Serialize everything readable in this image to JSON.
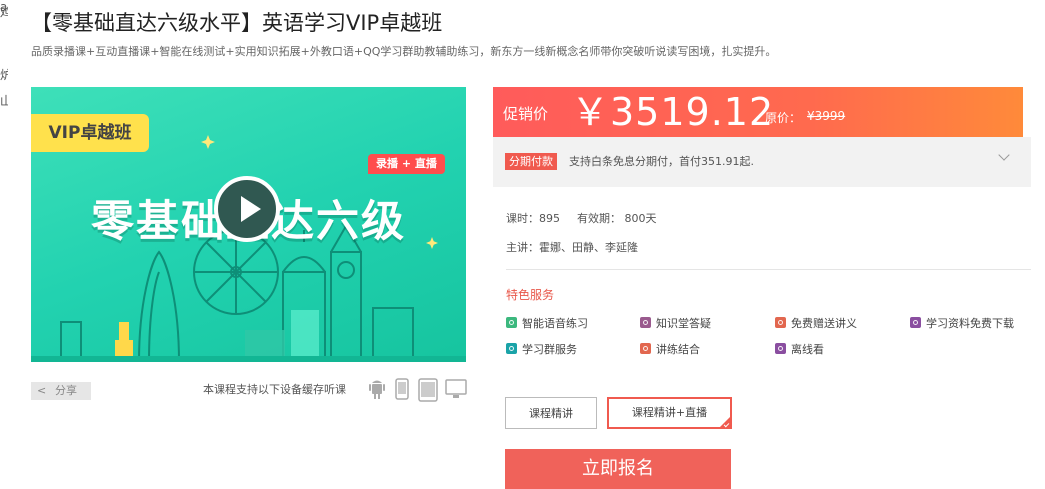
{
  "edge_chars": [
    "a",
    "鸡",
    "炉",
    "山"
  ],
  "page": {
    "title": "【零基础直达六级水平】英语学习VIP卓越班",
    "subtitle": "品质录播课+互动直播课+智能在线测试+实用知识拓展+外教口语+QQ学习群助教辅助练习，新东方一线新概念名师带你突破听说读写困境，扎实提升。"
  },
  "banner": {
    "vip_tag": "VIP卓越班",
    "live_tag": "录播 + 直播",
    "title": "零基础直达六级"
  },
  "share": {
    "label": "分享",
    "device_note": "本课程支持以下设备缓存听课",
    "devices": [
      "android-icon",
      "phone-icon",
      "tablet-icon",
      "desktop-icon"
    ]
  },
  "price": {
    "label": "促销价",
    "value": "￥3519.12",
    "original_label": "原价：",
    "original_value": "¥3999"
  },
  "installment": {
    "tag": "分期付款",
    "text": "支持白条免息分期付，首付351.91起."
  },
  "meta": {
    "lessons_label": "课时：",
    "lessons": "895",
    "validity_label": "有效期：",
    "validity": "800天",
    "lecturers_label": "主讲：",
    "lecturers": "霍娜、田静、李延隆"
  },
  "features": {
    "heading": "特色服务",
    "items": [
      {
        "label": "智能语音练习",
        "color": "#3cb87e"
      },
      {
        "label": "知识堂答疑",
        "color": "#9a5a8e"
      },
      {
        "label": "免费赠送讲义",
        "color": "#e2674f"
      },
      {
        "label": "学习资料免费下载",
        "color": "#8a4ea0"
      },
      {
        "label": "学习群服务",
        "color": "#1aa3a8"
      },
      {
        "label": "讲练结合",
        "color": "#e2674f"
      },
      {
        "label": "离线看",
        "color": "#8a4ea0"
      }
    ]
  },
  "options": {
    "opt1": "课程精讲",
    "opt2": "课程精讲+直播"
  },
  "buy": {
    "label": "立即报名"
  },
  "colors": {
    "accent": "#f05a4f",
    "banner_green": "#22d2b0",
    "vip_yellow": "#ffe14c"
  }
}
